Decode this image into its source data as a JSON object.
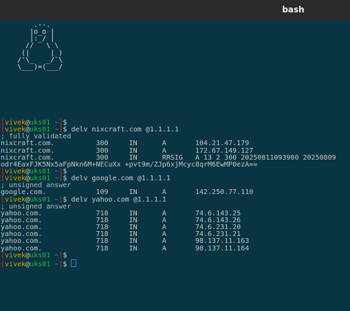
{
  "window": {
    "title": "bash"
  },
  "terminal": {
    "ascii_art": [
      "        .--.",
      "       |o_o |",
      "       |:_/ |",
      "      //   \\ \\",
      "     (|     | )",
      "    /'\\_   _/`\\",
      "    \\___)=(___/",
      "",
      "",
      "",
      "",
      "",
      "",
      ""
    ],
    "prompt": {
      "user": "vivek",
      "at": "@",
      "host": "uks01",
      "path": "~",
      "lbr": "[",
      "rbr": "]",
      "sign": "$"
    },
    "commands": {
      "c1": "delv nixcraft.com @1.1.1.1",
      "c2": "delv google.com @1.1.1.1",
      "c3": "delv yahoo.com @1.1.1.1"
    },
    "output": {
      "nix_status": "; fully validated",
      "nix_rows": [
        "nixcraft.com.          300     IN      A       104.21.47.179",
        "nixcraft.com.          300     IN      A       172.67.149.127",
        "nixcraft.com.          300     IN      RRSIG   A 13 2 300 20250811093900 20250809",
        "odr4EaxFJK5Nx5aFpNkn6M+NECuXx +pvt9m/ZJp6xjMcyc8qrM6EwMP0ezA=="
      ],
      "google_status": "; unsigned answer",
      "google_rows": [
        "google.com.            109     IN      A       142.250.77.110"
      ],
      "yahoo_status": "; unsigned answer",
      "yahoo_rows": [
        "yahoo.com.             718     IN      A       74.6.143.25",
        "yahoo.com.             718     IN      A       74.6.143.26",
        "yahoo.com.             718     IN      A       74.6.231.20",
        "yahoo.com.             718     IN      A       74.6.231.21",
        "yahoo.com.             718     IN      A       98.137.11.163",
        "yahoo.com.             718     IN      A       98.137.11.164"
      ]
    },
    "colors": {
      "background": "#083443",
      "user": "#d6a000",
      "host": "#2fb53a",
      "bracket": "#cc2a2a",
      "path": "#3b8fd9"
    }
  }
}
